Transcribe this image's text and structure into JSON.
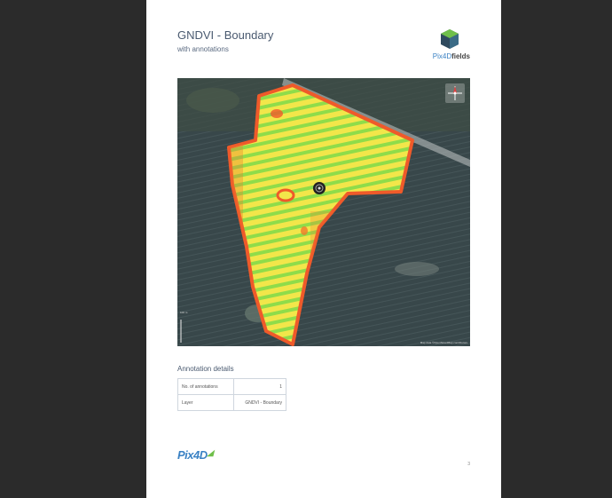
{
  "document": {
    "title": "GNDVI - Boundary",
    "subtitle": "with annotations",
    "brand": {
      "prefix": "Pix4D",
      "suffix": "fields"
    },
    "map": {
      "scale_label": "100 m",
      "attribution": "Map data ©OpenStreetMap contributors"
    },
    "annotation_section": {
      "heading": "Annotation details",
      "rows": [
        {
          "label": "No. of annotations",
          "value": "1"
        },
        {
          "label": "Layer",
          "value": "GNDVI - Boundary"
        }
      ]
    },
    "footer": {
      "logo": "Pix4D",
      "page_number": "3"
    },
    "colors": {
      "background": "#2b2b2b",
      "page": "#ffffff",
      "heading": "#4a5a70",
      "brand_blue": "#3b82c4",
      "brand_green": "#6fbf4a",
      "field_high": "#9be04a",
      "field_mid": "#f5e84a",
      "field_low": "#ef5a2a"
    }
  }
}
